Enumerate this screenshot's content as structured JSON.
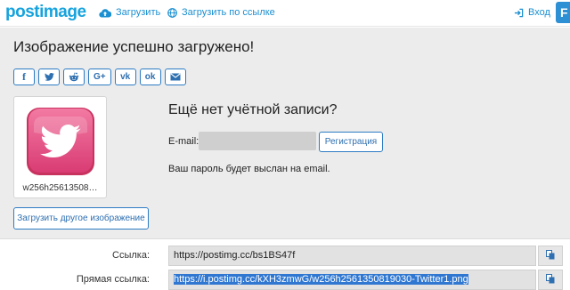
{
  "nav": {
    "logo": "postimage",
    "upload_label": "Загрузить",
    "upload_url_label": "Загрузить по ссылке",
    "login_label": "Вход",
    "edge_button": "F"
  },
  "main": {
    "title": "Изображение успешно загружено!",
    "share_buttons": [
      {
        "name": "facebook",
        "label": "f"
      },
      {
        "name": "twitter",
        "icon": "twitter-icon"
      },
      {
        "name": "reddit",
        "icon": "reddit-icon"
      },
      {
        "name": "google-plus",
        "label": "G+"
      },
      {
        "name": "vk",
        "label": "vk"
      },
      {
        "name": "odnoklassniki",
        "label": "ok"
      },
      {
        "name": "email",
        "icon": "envelope-icon"
      }
    ],
    "thumbnail": {
      "filename": "w256h25613508…",
      "icon": "twitter-icon",
      "tile_color": "#e5487e"
    },
    "upload_other_label": "Загрузить другое изображение",
    "no_account_heading": "Ещё нет учётной записи?",
    "email_label": "E-mail:",
    "email_value": "",
    "register_label": "Регистрация",
    "password_note": "Ваш пароль будет выслан на email."
  },
  "links": [
    {
      "label": "Ссылка:",
      "value": "https://postimg.cc/bs1BS47f",
      "selected": false
    },
    {
      "label": "Прямая ссылка:",
      "value": "https://i.postimg.cc/kXH3zmwG/w256h2561350819030-Twitter1.png",
      "selected": true
    }
  ],
  "colors": {
    "accent": "#1a8fd1",
    "button_border": "#2d7cc4",
    "panel_bg": "#ececec",
    "selection": "#2f77d1"
  }
}
